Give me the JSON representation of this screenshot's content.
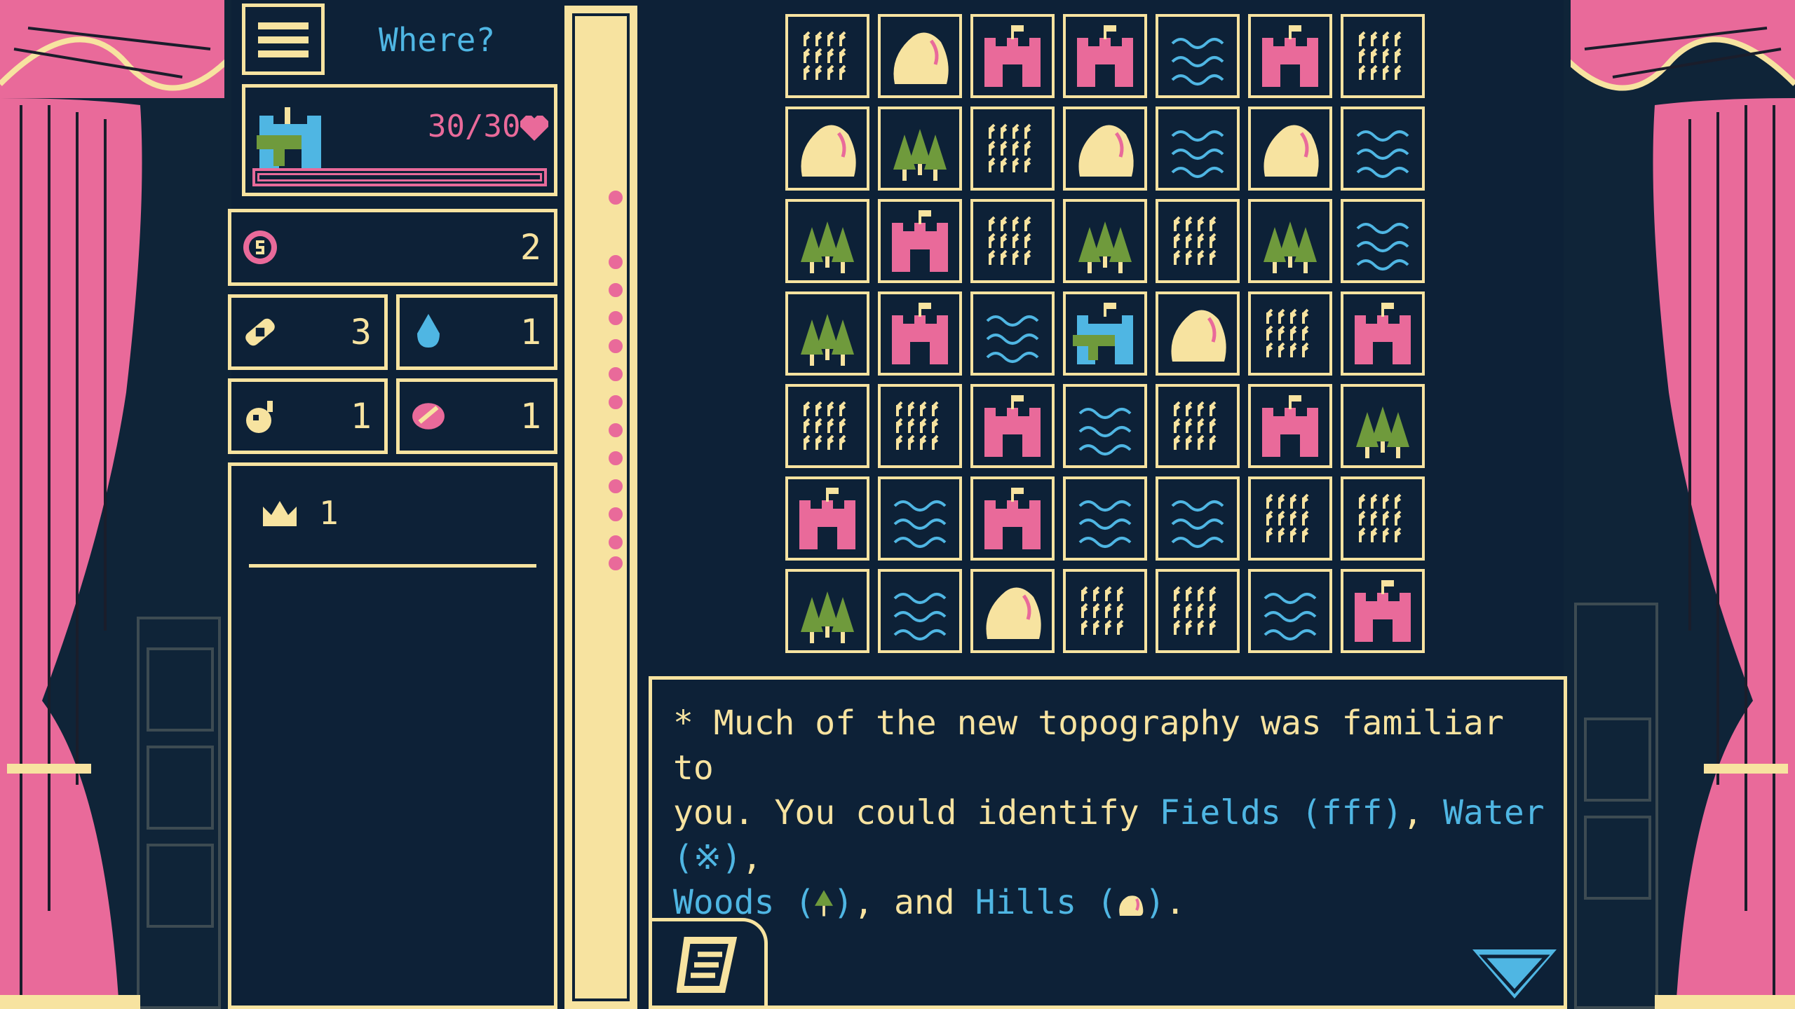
{
  "header": {
    "prompt": "Where?"
  },
  "player": {
    "hp_text": "30/30"
  },
  "stats": {
    "coins": "2",
    "bandage": "3",
    "water": "1",
    "bomb": "1",
    "gem": "1"
  },
  "crowns": {
    "count": "1"
  },
  "map": {
    "rows": [
      [
        "fields",
        "hills",
        "castle",
        "castle",
        "water",
        "castle",
        "fields"
      ],
      [
        "hills",
        "woods",
        "fields",
        "hills",
        "water",
        "hills",
        "water"
      ],
      [
        "woods",
        "castle",
        "fields",
        "woods",
        "fields",
        "woods",
        "water"
      ],
      [
        "woods",
        "castle",
        "water",
        "player",
        "hills",
        "fields",
        "castle"
      ],
      [
        "fields",
        "fields",
        "castle",
        "water",
        "fields",
        "castle",
        "woods"
      ],
      [
        "castle",
        "water",
        "castle",
        "water",
        "water",
        "fields",
        "fields"
      ],
      [
        "woods",
        "water",
        "hills",
        "fields",
        "fields",
        "water",
        "castle"
      ]
    ]
  },
  "narrative": {
    "part1": "* Much of the new topography was familiar to\nyou. You could identify ",
    "fields": "Fields (",
    "fields_sym": "fff",
    "fields_close": ")",
    "sep1": ", ",
    "water": "Water (",
    "water_sym": "※",
    "water_close": ")",
    "sep2": ",\n",
    "woods": "Woods (",
    "woods_close": ")",
    "sep3": ", and ",
    "hills": "Hills (",
    "hills_close": ")",
    "end": "."
  },
  "colors": {
    "background": "#0d2137",
    "cream": "#f7e3a0",
    "pink": "#e96a9a",
    "blue": "#4fb6e3",
    "green": "#6f9a3c"
  },
  "icons": {
    "menu": "hamburger-icon",
    "heart": "heart-icon",
    "coin": "coin-icon",
    "bandage": "bandage-icon",
    "water": "water-drop-icon",
    "bomb": "bomb-icon",
    "gem": "gem-icon",
    "crown": "crown-icon",
    "journal": "scroll-icon",
    "next": "triangle-down-icon"
  }
}
